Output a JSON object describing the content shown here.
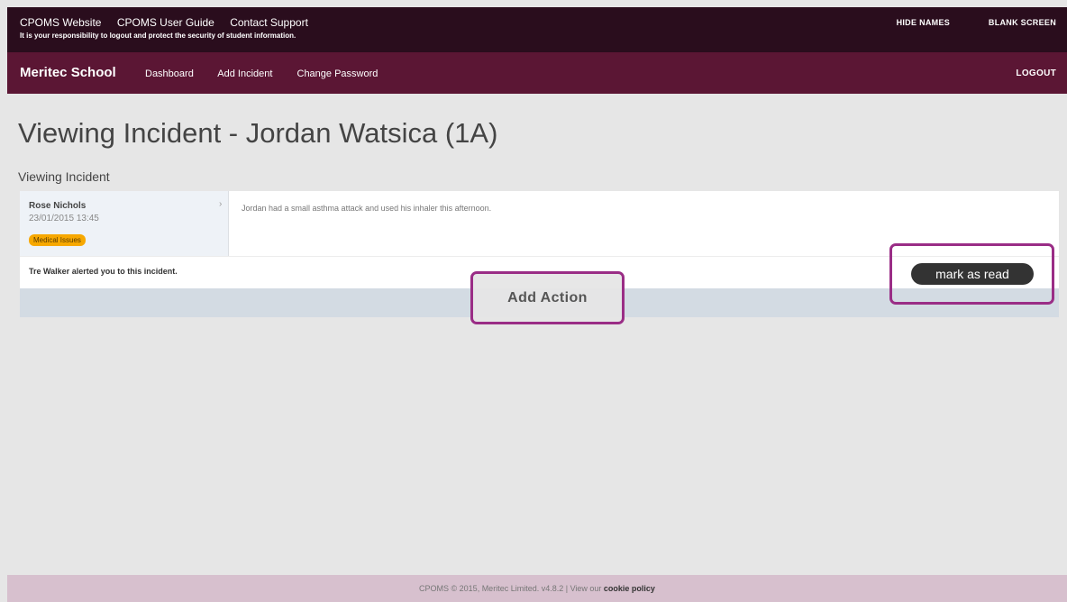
{
  "top_bar": {
    "links": [
      "CPOMS Website",
      "CPOMS User Guide",
      "Contact Support"
    ],
    "warning": "It is your responsibility to logout and protect the security of student information.",
    "right_links": [
      "HIDE NAMES",
      "BLANK SCREEN"
    ]
  },
  "nav": {
    "brand": "Meritec School",
    "links": [
      "Dashboard",
      "Add Incident",
      "Change Password"
    ],
    "logout": "LOGOUT"
  },
  "page": {
    "title": "Viewing Incident - Jordan Watsica (1A)",
    "section_title": "Viewing Incident"
  },
  "incident": {
    "author": "Rose Nichols",
    "datetime": "23/01/2015 13:45",
    "category": "Medical Issues",
    "arrow": "›",
    "description": "Jordan had a small asthma attack and used his inhaler this afternoon.",
    "alert": "Tre Walker alerted you to this incident.",
    "mark_read_label": "mark as read",
    "add_action_label": "Add Action"
  },
  "footer": {
    "prefix": "CPOMS © 2015, Meritec Limited. v4.8.2 | View our ",
    "link": "cookie policy"
  },
  "colors": {
    "utility_bar": "#2a0d1d",
    "nav_bar": "#5b1634",
    "badge": "#f7a800",
    "highlight": "#9a2d86",
    "footer": "#d7c0ce"
  }
}
